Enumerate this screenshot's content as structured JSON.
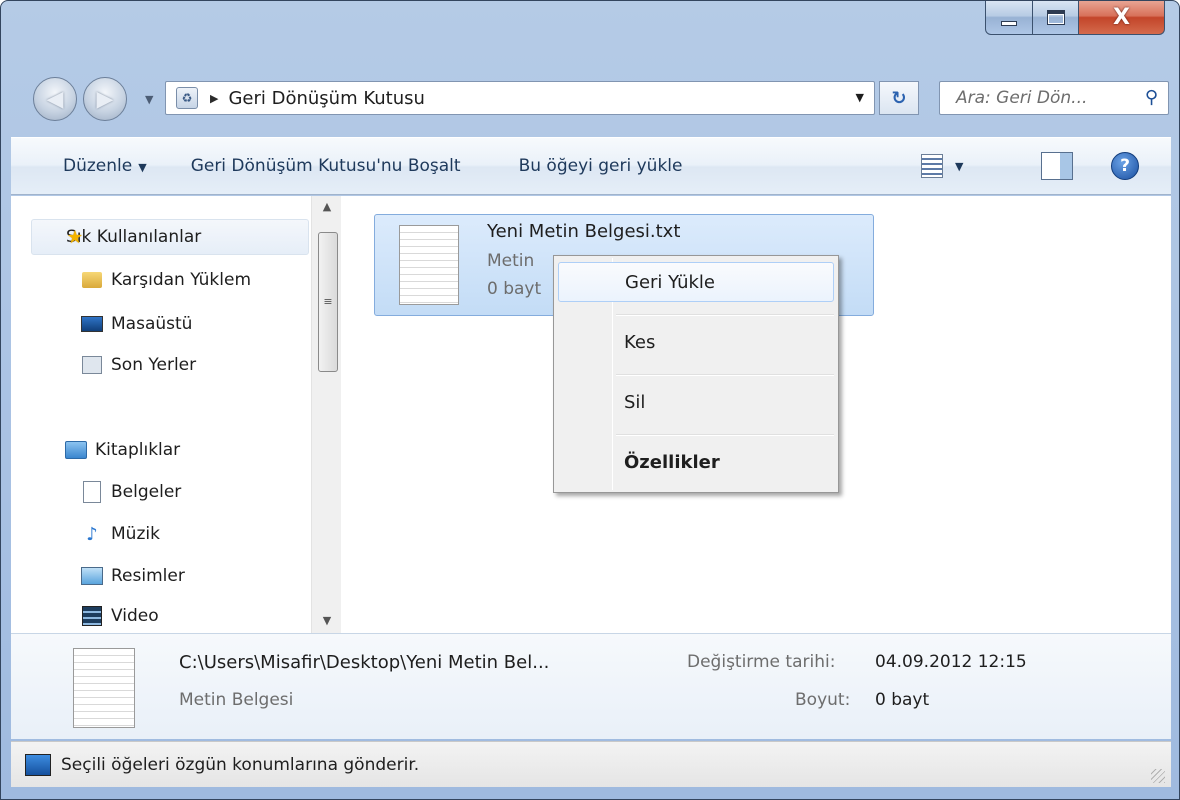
{
  "window": {
    "close_glyph": "X"
  },
  "address": {
    "separator": "▶",
    "path": "Geri Dönüşüm Kutusu",
    "refresh_glyph": "↻"
  },
  "search": {
    "placeholder": "Ara: Geri Dön...",
    "icon": "magnifier-icon"
  },
  "toolbar": {
    "organize_label": "Düzenle",
    "empty_label": "Geri Dönüşüm Kutusu'nu Boşalt",
    "restore_label": "Bu öğeyi geri yükle",
    "help_glyph": "?"
  },
  "sidebar": {
    "favorites": {
      "label": "Sık Kullanılanlar",
      "items": [
        {
          "label": "Karşıdan Yüklem",
          "icon": "downloads-folder-icon"
        },
        {
          "label": "Masaüstü",
          "icon": "desktop-icon"
        },
        {
          "label": "Son Yerler",
          "icon": "recent-places-icon"
        }
      ]
    },
    "libraries": {
      "label": "Kitaplıklar",
      "items": [
        {
          "label": "Belgeler",
          "icon": "documents-icon"
        },
        {
          "label": "Müzik",
          "icon": "music-icon"
        },
        {
          "label": "Resimler",
          "icon": "pictures-icon"
        },
        {
          "label": "Video",
          "icon": "video-icon"
        }
      ]
    }
  },
  "file": {
    "name": "Yeni Metin Belgesi.txt",
    "type": "Metin",
    "size": "0 bayt",
    "icon": "text-file-icon"
  },
  "context_menu": {
    "items": [
      {
        "label": "Geri Yükle",
        "highlighted": true
      },
      {
        "label": "Kes"
      },
      {
        "label": "Sil"
      },
      {
        "label": "Özellikler",
        "bold": true
      }
    ]
  },
  "details": {
    "path": "C:\\Users\\Misafir\\Desktop\\Yeni Metin Bel...",
    "type": "Metin Belgesi",
    "modified_label": "Değiştirme tarihi:",
    "modified_value": "04.09.2012 12:15",
    "size_label": "Boyut:",
    "size_value": "0 bayt"
  },
  "status": {
    "text": "Seçili öğeleri özgün konumlarına gönderir."
  },
  "colors": {
    "frame": "#a8c1e3",
    "selection": "#c3dcf6",
    "close_button": "#c3452a"
  }
}
